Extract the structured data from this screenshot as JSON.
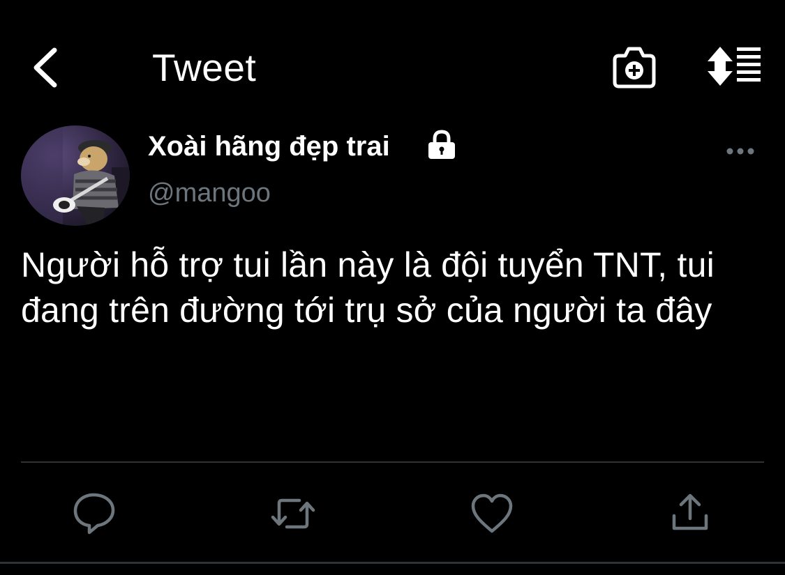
{
  "header": {
    "title": "Tweet",
    "back_icon": "chevron-left-icon",
    "camera_icon": "camera-add-icon",
    "sort_icon": "sort-list-icon"
  },
  "tweet": {
    "author": {
      "display_name": "Xoài hãng đẹp trai",
      "handle": "@mangoo",
      "protected_icon": "lock-icon",
      "avatar": "avatar-image"
    },
    "text": "Người hỗ trợ tui lần này là đội tuyển TNT, tui đang trên đường tới trụ sở của người ta đây",
    "more_icon": "ellipsis-icon"
  },
  "actions": [
    {
      "name": "reply",
      "icon": "reply-icon"
    },
    {
      "name": "retweet",
      "icon": "retweet-icon"
    },
    {
      "name": "like",
      "icon": "heart-icon"
    },
    {
      "name": "share",
      "icon": "share-icon"
    }
  ],
  "colors": {
    "background": "#000000",
    "text": "#ffffff",
    "secondary_text": "#6e767d",
    "icon": "#6e767d",
    "divider": "#2f3336"
  }
}
